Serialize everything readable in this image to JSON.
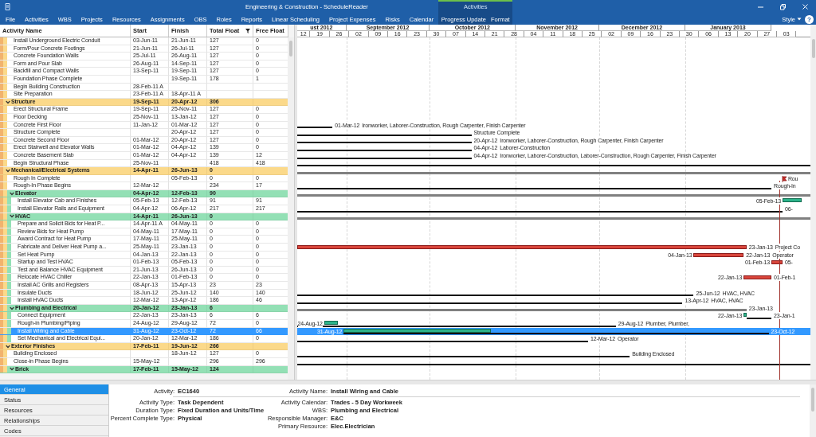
{
  "window": {
    "title": "Engineering & Construction - ScheduleReader"
  },
  "ribbon": {
    "tabs": [
      {
        "label": "File",
        "selected": false
      },
      {
        "label": "Activities",
        "selected": false
      },
      {
        "label": "WBS",
        "selected": false
      },
      {
        "label": "Projects",
        "selected": false
      },
      {
        "label": "Resources",
        "selected": false
      },
      {
        "label": "Assignments",
        "selected": false
      },
      {
        "label": "OBS",
        "selected": false
      },
      {
        "label": "Roles",
        "selected": false
      },
      {
        "label": "Reports",
        "selected": false
      },
      {
        "label": "Linear Scheduling",
        "selected": false
      },
      {
        "label": "Project Expenses",
        "selected": false
      },
      {
        "label": "Risks",
        "selected": false
      },
      {
        "label": "Calendar",
        "selected": false
      }
    ],
    "context_group": {
      "label": "Activities",
      "tabs": [
        {
          "label": "Progress Update",
          "selected": false
        },
        {
          "label": "Format",
          "selected": false
        }
      ]
    },
    "style_menu": "Style",
    "help": "?"
  },
  "table": {
    "columns": [
      {
        "label": "Activity Name",
        "filtered": false
      },
      {
        "label": "Start",
        "filtered": false
      },
      {
        "label": "Finish",
        "filtered": false
      },
      {
        "label": "Total Float",
        "filtered": true
      },
      {
        "label": "Free Float",
        "filtered": false
      }
    ],
    "rows": [
      {
        "kind": "task",
        "name": "Install Underground Electric Conduit",
        "start": "03-Jun-11",
        "finish": "21-Jun-11",
        "total_float": "127",
        "free_float": "0",
        "selected": false
      },
      {
        "kind": "task",
        "name": "Form/Pour Concrete Footings",
        "start": "21-Jun-11",
        "finish": "26-Jul-11",
        "total_float": "127",
        "free_float": "0",
        "selected": false
      },
      {
        "kind": "task",
        "name": "Concrete Foundation Walls",
        "start": "25-Jul-11",
        "finish": "26-Aug-11",
        "total_float": "127",
        "free_float": "0",
        "selected": false
      },
      {
        "kind": "task",
        "name": "Form and Pour Slab",
        "start": "26-Aug-11",
        "finish": "14-Sep-11",
        "total_float": "127",
        "free_float": "0",
        "selected": false
      },
      {
        "kind": "task",
        "name": "Backfill and Compact Walls",
        "start": "13-Sep-11",
        "finish": "19-Sep-11",
        "total_float": "127",
        "free_float": "0",
        "selected": false
      },
      {
        "kind": "task",
        "name": "Foundation Phase Complete",
        "finish": "19-Sep-11",
        "total_float": "178",
        "free_float": "1",
        "selected": false
      },
      {
        "kind": "task",
        "name": "Begin Building Construction",
        "start": "28-Feb-11 A",
        "selected": false
      },
      {
        "kind": "task",
        "name": "Site Preparation",
        "start": "23-Feb-11 A",
        "finish": "18-Apr-11 A",
        "selected": false
      },
      {
        "kind": "wbs",
        "name": "Structure",
        "start": "19-Sep-11",
        "finish": "20-Apr-12",
        "total_float": "306",
        "color": "#fbd98a",
        "expanded": true,
        "selected": false,
        "children": [
          {
            "kind": "task",
            "name": "Erect Structural Frame",
            "start": "19-Sep-11",
            "finish": "25-Nov-11",
            "total_float": "127",
            "free_float": "0",
            "selected": false
          },
          {
            "kind": "task",
            "name": "Floor Decking",
            "start": "25-Nov-11",
            "finish": "13-Jan-12",
            "total_float": "127",
            "free_float": "0",
            "selected": false
          },
          {
            "kind": "task",
            "name": "Concrete First Floor",
            "start": "11-Jan-12",
            "finish": "01-Mar-12",
            "total_float": "127",
            "free_float": "0",
            "selected": false,
            "gantt": {
              "bars": [
                {
                  "kind": "float"
                }
              ],
              "right_date": "01-Mar-12",
              "right_text": "Ironworker, Laborer-Construction, Rough Carpenter, Finish Carpenter"
            }
          },
          {
            "kind": "task",
            "name": "Structure Complete",
            "finish": "20-Apr-12",
            "total_float": "127",
            "free_float": "0",
            "selected": false,
            "gantt": {
              "bars": [
                {
                  "kind": "float"
                }
              ],
              "right_text": "Structure Complete"
            }
          },
          {
            "kind": "task",
            "name": "Concrete Second Floor",
            "start": "01-Mar-12",
            "finish": "20-Apr-12",
            "total_float": "127",
            "free_float": "0",
            "selected": false,
            "gantt": {
              "bars": [
                {
                  "kind": "float"
                }
              ],
              "right_date": "20-Apr-12",
              "right_text": "Ironworker, Laborer-Construction, Rough Carpenter, Finish Carpenter"
            }
          },
          {
            "kind": "task",
            "name": "Erect Stairwell and Elevator Walls",
            "start": "01-Mar-12",
            "finish": "04-Apr-12",
            "total_float": "139",
            "free_float": "0",
            "selected": false,
            "gantt": {
              "bars": [
                {
                  "kind": "float"
                }
              ],
              "right_date": "04-Apr-12",
              "right_text": "Laborer-Construction"
            }
          },
          {
            "kind": "task",
            "name": "Concrete Basement Slab",
            "start": "01-Mar-12",
            "finish": "04-Apr-12",
            "total_float": "139",
            "free_float": "12",
            "selected": false,
            "gantt": {
              "bars": [
                {
                  "kind": "float"
                }
              ],
              "right_date": "04-Apr-12",
              "right_text": "Ironworker, Laborer-Construction, Laborer-Construction, Rough Carpenter, Finish Carpenter"
            }
          },
          {
            "kind": "task",
            "name": "Begin Structural Phase",
            "start": "25-Nov-11",
            "total_float": "418",
            "free_float": "418",
            "selected": false,
            "gantt": {
              "bars": [
                {
                  "kind": "float"
                }
              ]
            }
          }
        ]
      },
      {
        "kind": "wbs",
        "name": "Mechanical/Electrical Systems",
        "start": "14-Apr-11",
        "finish": "26-Jun-13",
        "total_float": "0",
        "color": "#fbd98a",
        "expanded": true,
        "selected": false,
        "gantt": {
          "bars": [
            {
              "kind": "summary"
            }
          ]
        },
        "children": [
          {
            "kind": "task",
            "name": "Rough In Complete",
            "finish": "05-Feb-13",
            "total_float": "0",
            "free_float": "0",
            "selected": false,
            "gantt": {
              "bars": [
                {
                  "kind": "milestone"
                }
              ],
              "right_text": "Rou"
            }
          },
          {
            "kind": "task",
            "name": "Rough-In Phase Begins",
            "start": "12-Mar-12",
            "total_float": "234",
            "free_float": "17",
            "selected": false,
            "gantt": {
              "bars": [
                {
                  "kind": "float"
                }
              ],
              "right_text": "Rough-In"
            }
          },
          {
            "kind": "wbs",
            "name": "Elevator",
            "start": "04-Apr-12",
            "finish": "12-Feb-13",
            "total_float": "90",
            "color": "#93e0b5",
            "expanded": true,
            "selected": false,
            "gantt": {
              "bars": [
                {
                  "kind": "summary"
                }
              ]
            },
            "children": [
              {
                "kind": "task",
                "name": "Install Elevator Cab and Finishes",
                "start": "05-Feb-13",
                "finish": "12-Feb-13",
                "total_float": "91",
                "free_float": "91",
                "selected": false,
                "gantt": {
                  "left_date": "05-Feb-13",
                  "bars": [
                    {
                      "kind": "progress"
                    }
                  ]
                }
              },
              {
                "kind": "task",
                "name": "Install Elevator Rails and Equipment",
                "start": "04-Apr-12",
                "finish": "06-Apr-12",
                "total_float": "217",
                "free_float": "217",
                "selected": false,
                "gantt": {
                  "bars": [
                    {
                      "kind": "float"
                    }
                  ],
                  "right_date": "06-"
                }
              }
            ]
          },
          {
            "kind": "wbs",
            "name": "HVAC",
            "start": "14-Apr-11",
            "finish": "26-Jun-13",
            "total_float": "0",
            "color": "#93e0b5",
            "expanded": true,
            "selected": false,
            "gantt": {
              "bars": [
                {
                  "kind": "summary"
                }
              ]
            },
            "children": [
              {
                "kind": "task",
                "name": "Prepare and Solicit Bids for Heat P...",
                "start": "14-Apr-11 A",
                "finish": "04-May-11",
                "total_float": "0",
                "free_float": "0",
                "selected": false
              },
              {
                "kind": "task",
                "name": "Review Bids for Heat Pump",
                "start": "04-May-11",
                "finish": "17-May-11",
                "total_float": "0",
                "free_float": "0",
                "selected": false
              },
              {
                "kind": "task",
                "name": "Award Contract for Heat Pump",
                "start": "17-May-11",
                "finish": "25-May-11",
                "total_float": "0",
                "free_float": "0",
                "selected": false
              },
              {
                "kind": "task",
                "name": "Fabricate and Deliver Heat Pump a...",
                "start": "25-May-11",
                "finish": "23-Jan-13",
                "total_float": "0",
                "free_float": "0",
                "selected": false,
                "gantt": {
                  "bars": [
                    {
                      "kind": "critical"
                    }
                  ],
                  "right_date": "23-Jan-13",
                  "right_text": "Project Co"
                }
              },
              {
                "kind": "task",
                "name": "Set Heat Pump",
                "start": "04-Jan-13",
                "finish": "22-Jan-13",
                "total_float": "0",
                "free_float": "0",
                "selected": false,
                "gantt": {
                  "left_date": "04-Jan-13",
                  "bars": [
                    {
                      "kind": "critical"
                    }
                  ],
                  "right_date": "22-Jan-13",
                  "right_text": "Operator"
                }
              },
              {
                "kind": "task",
                "name": "Startup and Test HVAC",
                "start": "01-Feb-13",
                "finish": "05-Feb-13",
                "total_float": "0",
                "free_float": "0",
                "selected": false,
                "gantt": {
                  "left_date": "01-Feb-13",
                  "bars": [
                    {
                      "kind": "critical"
                    }
                  ],
                  "right_date": "05-"
                }
              },
              {
                "kind": "task",
                "name": "Test and Balance HVAC Equipment",
                "start": "21-Jun-13",
                "finish": "26-Jun-13",
                "total_float": "0",
                "free_float": "0",
                "selected": false
              },
              {
                "kind": "task",
                "name": "Relocate HVAC Chiller",
                "start": "22-Jan-13",
                "finish": "01-Feb-13",
                "total_float": "0",
                "free_float": "0",
                "selected": false,
                "gantt": {
                  "left_date": "22-Jan-13",
                  "bars": [
                    {
                      "kind": "critical"
                    }
                  ],
                  "right_date": "01-Feb-1"
                }
              },
              {
                "kind": "task",
                "name": "Install AC Grills and Registers",
                "start": "08-Apr-13",
                "finish": "15-Apr-13",
                "total_float": "23",
                "free_float": "23",
                "selected": false
              },
              {
                "kind": "task",
                "name": "Insulate Ducts",
                "start": "18-Jun-12",
                "finish": "25-Jun-12",
                "total_float": "140",
                "free_float": "140",
                "selected": false,
                "gantt": {
                  "bars": [
                    {
                      "kind": "float"
                    }
                  ],
                  "right_date": "25-Jun-12",
                  "right_text": "HVAC, HVAC"
                }
              },
              {
                "kind": "task",
                "name": "Install HVAC Ducts",
                "start": "12-Mar-12",
                "finish": "13-Apr-12",
                "total_float": "186",
                "free_float": "46",
                "selected": false,
                "gantt": {
                  "bars": [
                    {
                      "kind": "float"
                    }
                  ],
                  "right_date": "13-Apr-12",
                  "right_text": "HVAC, HVAC"
                }
              }
            ]
          },
          {
            "kind": "wbs",
            "name": "Plumbing and Electrical",
            "start": "20-Jan-12",
            "finish": "23-Jan-13",
            "total_float": "6",
            "color": "#93e0b5",
            "expanded": true,
            "selected": false,
            "gantt": {
              "bars": [
                {
                  "kind": "summary"
                }
              ],
              "right_date": "23-Jan-13"
            },
            "children": [
              {
                "kind": "task",
                "name": "Connect Equipment",
                "start": "22-Jan-13",
                "finish": "23-Jan-13",
                "total_float": "6",
                "free_float": "6",
                "selected": false,
                "gantt": {
                  "left_date": "22-Jan-13",
                  "bars": [
                    {
                      "kind": "float"
                    },
                    {
                      "kind": "progress"
                    }
                  ],
                  "right_date": "23-Jan-1"
                }
              },
              {
                "kind": "task",
                "name": "Rough-in Plumbing/Piping",
                "start": "24-Aug-12",
                "finish": "29-Aug-12",
                "total_float": "72",
                "free_float": "0",
                "selected": false,
                "gantt": {
                  "left_date": "24-Aug-12",
                  "bars": [
                    {
                      "kind": "float"
                    },
                    {
                      "kind": "progress"
                    }
                  ],
                  "right_date": "29-Aug-12",
                  "right_text": "Plumber, Plumber,"
                }
              },
              {
                "kind": "task",
                "name": "Install Wiring and Cable",
                "start": "31-Aug-12",
                "finish": "23-Oct-12",
                "total_float": "72",
                "free_float": "66",
                "selected": true,
                "gantt": {
                  "left_date": "31-Aug-12",
                  "bars": [
                    {
                      "kind": "float"
                    },
                    {
                      "kind": "progress"
                    }
                  ],
                  "right_date": "23-Oct-12"
                }
              },
              {
                "kind": "task",
                "name": "Set Mechanical and Electrical Equi...",
                "start": "20-Jan-12",
                "finish": "12-Mar-12",
                "total_float": "186",
                "free_float": "0",
                "selected": false,
                "gantt": {
                  "bars": [
                    {
                      "kind": "float"
                    }
                  ],
                  "right_date": "12-Mar-12",
                  "right_text": "Operator"
                }
              }
            ]
          }
        ]
      },
      {
        "kind": "wbs",
        "name": "Exterior Finishes",
        "start": "17-Feb-11",
        "finish": "19-Jun-12",
        "total_float": "266",
        "color": "#fbd98a",
        "expanded": true,
        "selected": false,
        "children": [
          {
            "kind": "task",
            "name": "Building Enclosed",
            "finish": "18-Jun-12",
            "total_float": "127",
            "free_float": "0",
            "selected": false,
            "gantt": {
              "bars": [
                {
                  "kind": "float"
                }
              ],
              "right_text": "Building Enclosed"
            }
          },
          {
            "kind": "task",
            "name": "Close-in Phase Begins",
            "start": "15-May-12",
            "total_float": "296",
            "free_float": "296",
            "selected": false,
            "gantt": {
              "bars": [
                {
                  "kind": "float"
                }
              ]
            }
          },
          {
            "kind": "wbs",
            "name": "Brick",
            "start": "17-Feb-11",
            "finish": "15-May-12",
            "total_float": "124",
            "color": "#93e0b5",
            "expanded": true,
            "selected": false
          }
        ]
      }
    ]
  },
  "gantt": {
    "months": [
      "ust 2012",
      "September 2012",
      "October 2012",
      "November 2012",
      "December 2012",
      "January 2013"
    ],
    "weeks": [
      "12",
      "19",
      "26",
      "02",
      "09",
      "16",
      "23",
      "30",
      "07",
      "14",
      "21",
      "28",
      "04",
      "11",
      "18",
      "25",
      "02",
      "09",
      "16",
      "23",
      "30",
      "06",
      "13",
      "20",
      "27",
      "03"
    ]
  },
  "details": {
    "tabs": [
      {
        "label": "General",
        "selected": true
      },
      {
        "label": "Status",
        "selected": false
      },
      {
        "label": "Resources",
        "selected": false
      },
      {
        "label": "Relationships",
        "selected": false
      },
      {
        "label": "Codes",
        "selected": false
      }
    ],
    "header_left": [
      {
        "label": "Activity:",
        "value": "EC1640"
      }
    ],
    "header_right": [
      {
        "label": "Activity Name:",
        "value": "Install Wiring and Cable"
      }
    ],
    "left": [
      {
        "label": "Activity Type:",
        "value": "Task Dependent"
      },
      {
        "label": "Duration Type:",
        "value": "Fixed Duration and Units/Time"
      },
      {
        "label": "Percent Complete Type:",
        "value": "Physical"
      }
    ],
    "right": [
      {
        "label": "Activity Calendar:",
        "value": "Trades -  5 Day Workweek"
      },
      {
        "label": "WBS:",
        "value": "Plumbing and Electrical"
      },
      {
        "label": "Responsible Manager:",
        "value": "E&C"
      },
      {
        "label": "Primary Resource:",
        "value": "Elec.Electrician"
      }
    ]
  }
}
